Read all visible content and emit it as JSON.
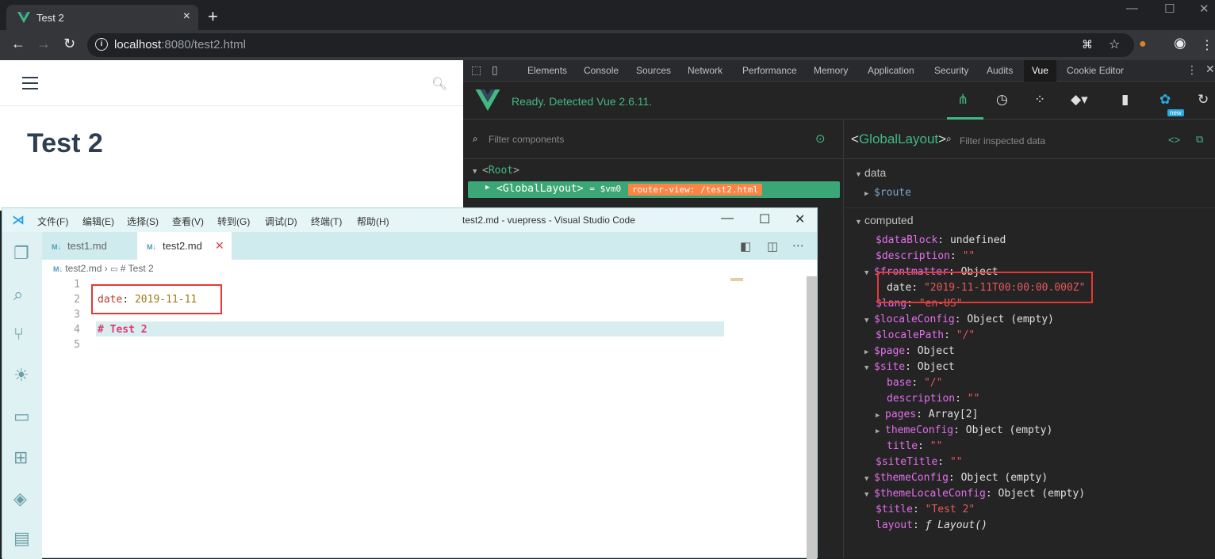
{
  "browser": {
    "tab_title": "Test 2",
    "url_host": "localhost",
    "url_rest": ":8080/test2.html",
    "win_controls": [
      "—",
      "☐",
      "✕"
    ]
  },
  "page": {
    "title": "Test 2"
  },
  "devtools": {
    "tabs": [
      "Elements",
      "Console",
      "Sources",
      "Network",
      "Performance",
      "Memory",
      "Application",
      "Security",
      "Audits",
      "Vue",
      "Cookie Editor"
    ],
    "active_tab": "Vue",
    "vue_status": "Ready. Detected Vue 2.6.11.",
    "new_badge": "new",
    "filter_components_placeholder": "Filter components",
    "tree": {
      "root": "Root",
      "global_layout": "GlobalLayout",
      "vm_ref": "= $vm0",
      "router_view": "router-view: /test2.html"
    },
    "inspector": {
      "component": "GlobalLayout",
      "filter_placeholder": "Filter inspected data",
      "data_label": "data",
      "route_key": "$route",
      "computed_label": "computed",
      "rows": [
        {
          "k": "$dataBlock",
          "v": "undefined"
        },
        {
          "k": "$description",
          "v": "\"\""
        },
        {
          "k": "$frontmatter",
          "v": "Object"
        },
        {
          "k": "date",
          "v": "\"2019-11-11T00:00:00.000Z\""
        },
        {
          "k": "$lang",
          "v": "\"en-US\""
        },
        {
          "k": "$localeConfig",
          "v": "Object (empty)"
        },
        {
          "k": "$localePath",
          "v": "\"/\""
        },
        {
          "k": "$page",
          "v": "Object"
        },
        {
          "k": "$site",
          "v": "Object"
        },
        {
          "k": "base",
          "v": "\"/\""
        },
        {
          "k": "description",
          "v": "\"\""
        },
        {
          "k": "pages",
          "v": "Array[2]"
        },
        {
          "k": "themeConfig",
          "v": "Object (empty)"
        },
        {
          "k": "title",
          "v": "\"\""
        },
        {
          "k": "$siteTitle",
          "v": "\"\""
        },
        {
          "k": "$themeConfig",
          "v": "Object (empty)"
        },
        {
          "k": "$themeLocaleConfig",
          "v": "Object (empty)"
        },
        {
          "k": "$title",
          "v": "\"Test 2\""
        },
        {
          "k": "layout",
          "v": "ƒ Layout()"
        }
      ]
    }
  },
  "vscode": {
    "menu": [
      "文件(F)",
      "编辑(E)",
      "选择(S)",
      "查看(V)",
      "转到(G)",
      "调试(D)",
      "终端(T)",
      "帮助(H)"
    ],
    "window_title": "test2.md - vuepress - Visual Studio Code",
    "tabs": [
      "test1.md",
      "test2.md"
    ],
    "tab_icon": "M↓",
    "breadcrumb_file": "test2.md",
    "breadcrumb_symbol": "# Test 2",
    "line_numbers": [
      "1",
      "2",
      "3",
      "4",
      "5"
    ],
    "code": {
      "line2_key": "date",
      "line2_sep": ": ",
      "line2_val": "2019-11-11",
      "line4": "# Test 2"
    }
  }
}
